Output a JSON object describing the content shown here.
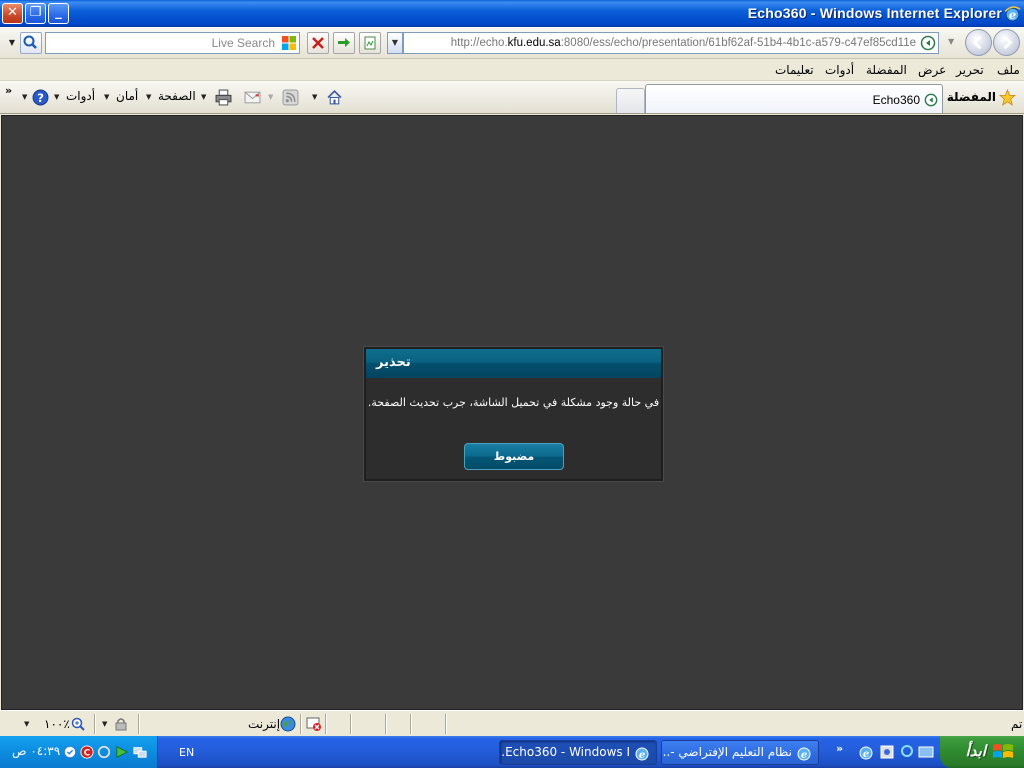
{
  "window": {
    "title": "Echo360 - Windows Internet Explorer"
  },
  "address_bar": {
    "search_placeholder": "Live Search",
    "url_prefix": "http://echo.",
    "url_domain": "kfu.edu.sa",
    "url_suffix": ":8080/ess/echo/presentation/61bf62af-51b4-4b1c-a579-c47ef85cd11e"
  },
  "menu": {
    "items": [
      "ملف",
      "تحرير",
      "عرض",
      "المفضلة",
      "أدوات",
      "تعليمات"
    ]
  },
  "command_bar": {
    "favorites_label": "المفضلة",
    "tab_label": "Echo360",
    "page_label": "الصفحة",
    "safety_label": "أمان",
    "tools_label": "أدوات",
    "more": "»"
  },
  "dialog": {
    "title": "تحذير",
    "message": "في حالة وجود مشكلة في تحميل الشاشة، جرب تحديث الصفحة.",
    "ok_label": "مضبوط"
  },
  "status_bar": {
    "done_text": "تم",
    "zone_text": "إنترنت",
    "zoom_text": "١٠٠٪"
  },
  "taskbar": {
    "start_label": "ابدأ",
    "language": "EN",
    "clock": "٠٤:٣٩ ص",
    "quick_launch_more": "»",
    "tasks": [
      {
        "label": "نظام التعليم الإفتراضي -...",
        "active": false
      },
      {
        "label": "Echo360 - Windows I...",
        "active": true
      }
    ]
  },
  "colors": {
    "dialog_header": "#0a6282",
    "content_bg": "#3a3a3a",
    "taskbar_blue": "#245edb",
    "start_green": "#3c9a3c"
  }
}
